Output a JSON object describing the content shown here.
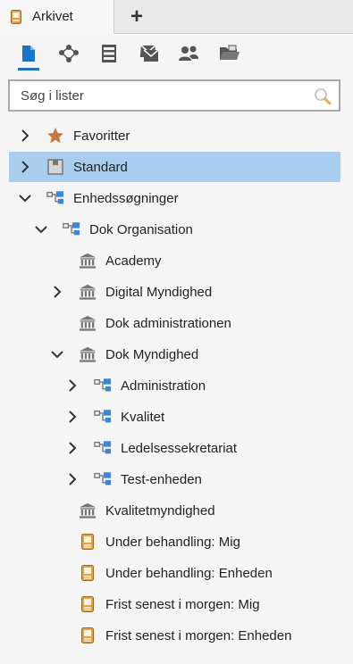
{
  "tab": {
    "label": "Arkivet",
    "icon": "document-icon",
    "add_label": "+"
  },
  "toolbar": {
    "items": [
      {
        "name": "documents-icon",
        "active": true
      },
      {
        "name": "network-icon",
        "active": false
      },
      {
        "name": "file-cabinet-icon",
        "active": false
      },
      {
        "name": "mail-icon",
        "active": false
      },
      {
        "name": "users-icon",
        "active": false
      },
      {
        "name": "folder-icon",
        "active": false
      }
    ],
    "accent": "#1a73c8"
  },
  "search": {
    "placeholder": "Søg i lister",
    "value": ""
  },
  "tree": {
    "items": [
      {
        "label": "Favoritter",
        "icon": "star-icon",
        "expander": "collapsed",
        "depth": 0,
        "selected": false
      },
      {
        "label": "Standard",
        "icon": "box-icon",
        "expander": "collapsed",
        "depth": 0,
        "selected": true
      },
      {
        "label": "Enhedssøgninger",
        "icon": "org-unit-icon",
        "expander": "expanded",
        "depth": 0,
        "selected": false
      },
      {
        "label": "Dok Organisation",
        "icon": "org-unit-icon",
        "expander": "expanded",
        "depth": 1,
        "selected": false
      },
      {
        "label": "Academy",
        "icon": "institution-icon",
        "expander": "none",
        "depth": 2,
        "selected": false
      },
      {
        "label": "Digital Myndighed",
        "icon": "institution-icon",
        "expander": "collapsed",
        "depth": 2,
        "selected": false
      },
      {
        "label": "Dok administrationen",
        "icon": "institution-icon",
        "expander": "none",
        "depth": 2,
        "selected": false
      },
      {
        "label": "Dok Myndighed",
        "icon": "institution-icon",
        "expander": "expanded",
        "depth": 2,
        "selected": false
      },
      {
        "label": "Administration",
        "icon": "org-unit-icon",
        "expander": "collapsed",
        "depth": 3,
        "selected": false
      },
      {
        "label": "Kvalitet",
        "icon": "org-unit-icon",
        "expander": "collapsed",
        "depth": 3,
        "selected": false
      },
      {
        "label": "Ledelsessekretariat",
        "icon": "org-unit-icon",
        "expander": "collapsed",
        "depth": 3,
        "selected": false
      },
      {
        "label": "Test-enheden",
        "icon": "org-unit-icon",
        "expander": "collapsed",
        "depth": 3,
        "selected": false
      },
      {
        "label": "Kvalitetmyndighed",
        "icon": "institution-icon",
        "expander": "none",
        "depth": 2,
        "selected": false
      },
      {
        "label": "Under behandling: Mig",
        "icon": "document-icon",
        "expander": "none",
        "depth": 2,
        "selected": false
      },
      {
        "label": "Under behandling: Enheden",
        "icon": "document-icon",
        "expander": "none",
        "depth": 2,
        "selected": false
      },
      {
        "label": "Frist senest i morgen: Mig",
        "icon": "document-icon",
        "expander": "none",
        "depth": 2,
        "selected": false
      },
      {
        "label": "Frist senest i morgen: Enheden",
        "icon": "document-icon",
        "expander": "none",
        "depth": 2,
        "selected": false
      }
    ]
  },
  "colors": {
    "selected_bg": "#a9cdee",
    "star": "#c8773a",
    "org_blue": "#3c86d6",
    "doc_orange": "#e3a24a"
  }
}
